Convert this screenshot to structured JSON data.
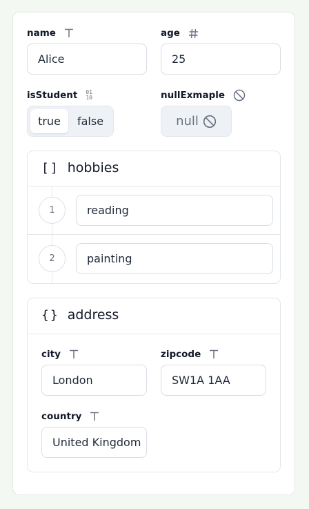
{
  "fields": {
    "name": {
      "label": "name",
      "value": "Alice",
      "type_icon": "text-type-icon"
    },
    "age": {
      "label": "age",
      "value": "25",
      "type_icon": "number-type-icon"
    },
    "isStudent": {
      "label": "isStudent",
      "type_icon": "boolean-type-icon",
      "glyph": "01\n10",
      "options": [
        "true",
        "false"
      ],
      "selected": "true"
    },
    "nullExample": {
      "label": "nullExmaple",
      "value": "null",
      "type_icon": "null-type-icon"
    }
  },
  "hobbies": {
    "title": "hobbies",
    "bracket": "[]",
    "items": [
      {
        "index": "1",
        "value": "reading"
      },
      {
        "index": "2",
        "value": "painting"
      }
    ]
  },
  "address": {
    "title": "address",
    "bracket": "{}",
    "city": {
      "label": "city",
      "value": "London"
    },
    "zipcode": {
      "label": "zipcode",
      "value": "SW1A 1AA"
    },
    "country": {
      "label": "country",
      "value": "United Kingdom"
    }
  },
  "colors": {
    "background": "#f3f8f2",
    "card": "#ffffff",
    "border": "#d8dde3",
    "muted": "#6b7280",
    "segment_bg": "#eef1f5"
  }
}
